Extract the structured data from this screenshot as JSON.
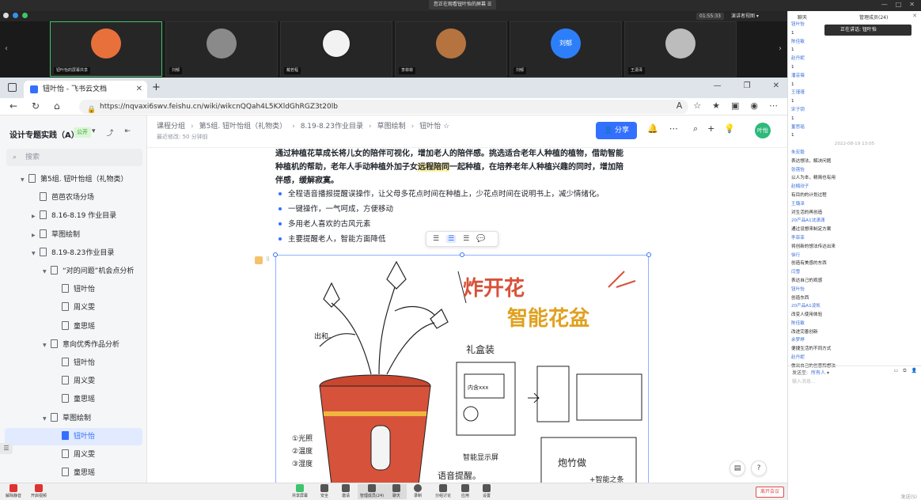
{
  "meeting": {
    "sharing_banner": "您正在观看钮叶怡的屏幕",
    "timer": "01:55:33",
    "speaker_view": "演讲者视图",
    "tiles": [
      {
        "name": "钮叶怡的屏幕共享",
        "avatar_color": "#e8703a",
        "active": true
      },
      {
        "name": "刘郁",
        "avatar_color": "#8a8a8a",
        "active": false
      },
      {
        "name": "戴若程",
        "avatar_color": "#f2f2f2",
        "active": false
      },
      {
        "name": "李菲菲",
        "avatar_color": "#b5743f",
        "active": false
      },
      {
        "name": "刘郁",
        "avatar_color": "#2d7ff9",
        "avatar_text": "刘郁",
        "active": false
      },
      {
        "name": "王潇泽",
        "avatar_color": "#bcbcbc",
        "active": false
      }
    ],
    "toolbar": [
      {
        "label": "共享屏幕"
      },
      {
        "label": "安全"
      },
      {
        "label": "邀请"
      },
      {
        "label": "管理成员(24)"
      },
      {
        "label": "聊天"
      },
      {
        "label": "录制"
      },
      {
        "label": "分组讨论"
      },
      {
        "label": "应用"
      },
      {
        "label": "设置"
      }
    ],
    "mute_label": "解除静音",
    "video_label": "开启视频",
    "end_label": "离开会议"
  },
  "browser": {
    "tab_title": "钮叶怡 - 飞书云文档",
    "url": "https://nqvaxi6swv.feishu.cn/wiki/wikcnQQah4L5KXldGhRGZ3t20lb"
  },
  "doc": {
    "space_title": "设计专题实践（A）",
    "public_tag": "公开",
    "search_placeholder": "搜索",
    "tree": [
      {
        "label": "第5组. 钮叶怡组（礼物类）",
        "indent": 0,
        "caret": "▼"
      },
      {
        "label": "芭芭农场分场",
        "indent": 1,
        "caret": ""
      },
      {
        "label": "8.16-8.19 作业目录",
        "indent": 1,
        "caret": "▶"
      },
      {
        "label": "草图绘制",
        "indent": 1,
        "caret": "▶"
      },
      {
        "label": "8.19-8.23作业目录",
        "indent": 1,
        "caret": "▼"
      },
      {
        "label": "“对的问题”机会点分析",
        "indent": 2,
        "caret": "▼"
      },
      {
        "label": "钮叶怡",
        "indent": 3,
        "caret": ""
      },
      {
        "label": "周义雯",
        "indent": 3,
        "caret": ""
      },
      {
        "label": "童思瑶",
        "indent": 3,
        "caret": ""
      },
      {
        "label": "意向优秀作品分析",
        "indent": 2,
        "caret": "▼"
      },
      {
        "label": "钮叶怡",
        "indent": 3,
        "caret": ""
      },
      {
        "label": "周义雯",
        "indent": 3,
        "caret": ""
      },
      {
        "label": "童思瑶",
        "indent": 3,
        "caret": ""
      },
      {
        "label": "草图绘制",
        "indent": 2,
        "caret": "▼"
      },
      {
        "label": "钮叶怡",
        "indent": 3,
        "caret": "",
        "selected": true
      },
      {
        "label": "周义雯",
        "indent": 3,
        "caret": ""
      },
      {
        "label": "童思瑶",
        "indent": 3,
        "caret": ""
      }
    ],
    "breadcrumbs": [
      "课程分组",
      "第5组. 钮叶怡组（礼物类）",
      "8.19-8.23作业目录",
      "草图绘制",
      "钮叶怡"
    ],
    "last_edit": "最近修改: 50 分钟前",
    "share_label": "分享",
    "user_badge": "叶怡",
    "para_line1": "通过种植花草成长将儿女的陪伴可视化，增加老人的陪伴感。挑选适合老年人种植的植物，借助智能",
    "para_line2_a": "种植机的帮助，老年人手动种植外加子女",
    "para_line2_hl": "远程陪同",
    "para_line2_b": "一起种植，在培养老年人种植兴趣的同时，增加陪",
    "para_line3": "伴感，缓解寂寞。",
    "bullets": [
      "全程语音播报提醒误操作，让父母多花点时间在种植上，少花点时间在说明书上，减少情绪化。",
      "一键操作，一气呵成，方便移动",
      "多用老人喜欢的古风元素",
      "主要提醒老人，智能方面降低"
    ],
    "sketch": {
      "title1": "炸开花",
      "title2": "智能花盆",
      "gift_box": "礼盒装",
      "label_chu": "出和。",
      "label_light": "①光照",
      "label_temp": "②温度",
      "label_humid": "③湿度",
      "label_screen": "智能显示屏",
      "label_voice": "语音提醒。",
      "label_bamboo": "炮竹做",
      "label_extra": "+智能之条",
      "label_card": "内含xxx"
    }
  },
  "chat": {
    "tab_chat": "聊天",
    "tab_members": "管理成员(24)",
    "speaking": "正在讲话: 钮叶怡",
    "messages": [
      {
        "type": "name",
        "text": "钮叶怡"
      },
      {
        "type": "text",
        "text": "1"
      },
      {
        "type": "name",
        "text": "陈佳敏"
      },
      {
        "type": "text",
        "text": "1"
      },
      {
        "type": "name",
        "text": "赵丹妮"
      },
      {
        "type": "text",
        "text": "1"
      },
      {
        "type": "name",
        "text": "潘芸薇"
      },
      {
        "type": "text",
        "text": "1"
      },
      {
        "type": "name",
        "text": "王瑾瑾"
      },
      {
        "type": "text",
        "text": "1"
      },
      {
        "type": "name",
        "text": "宋子钥"
      },
      {
        "type": "text",
        "text": "1"
      },
      {
        "type": "name",
        "text": "董思瑶"
      },
      {
        "type": "text",
        "text": "1"
      },
      {
        "type": "time",
        "text": "2022-08-19 13:05"
      },
      {
        "type": "name",
        "text": "朱宏毅"
      },
      {
        "type": "text",
        "text": "表达想法，解决问题"
      },
      {
        "type": "name",
        "text": "张蓓怡"
      },
      {
        "type": "text",
        "text": "以人为本，精简也有用"
      },
      {
        "type": "name",
        "text": "赵楠欣子"
      },
      {
        "type": "text",
        "text": "有目的的计划过程"
      },
      {
        "type": "name",
        "text": "王璐泽"
      },
      {
        "type": "text",
        "text": "对生活的再创造"
      },
      {
        "type": "name",
        "text": "20产品A1沈潇潇"
      },
      {
        "type": "text",
        "text": "通过设想来制定方案"
      },
      {
        "type": "name",
        "text": "李菲菲"
      },
      {
        "type": "text",
        "text": "将创新的想法传达出来"
      },
      {
        "type": "name",
        "text": "徐行"
      },
      {
        "type": "text",
        "text": "创造有美感的东西"
      },
      {
        "type": "name",
        "text": "闫雪"
      },
      {
        "type": "text",
        "text": "表达自己的观感"
      },
      {
        "type": "name",
        "text": "钮叶怡"
      },
      {
        "type": "text",
        "text": "创造东西"
      },
      {
        "type": "name",
        "text": "20产品A1凌凯"
      },
      {
        "type": "text",
        "text": "改变人使用体验"
      },
      {
        "type": "name",
        "text": "陈佳敏"
      },
      {
        "type": "text",
        "text": "改进完善创新"
      },
      {
        "type": "name",
        "text": "余梦婷"
      },
      {
        "type": "text",
        "text": "便捷生活的不同方式"
      },
      {
        "type": "name",
        "text": "赵丹妮"
      },
      {
        "type": "text",
        "text": "做出自己的创意和想法"
      }
    ],
    "send_to_label": "发送至:",
    "send_to_target": "所有人",
    "input_placeholder": "输入消息...",
    "send_label": "发送(S)"
  },
  "colors": {
    "accent": "#3370ff",
    "meeting_green": "#3ec46d",
    "end_red": "#e24b4b"
  }
}
